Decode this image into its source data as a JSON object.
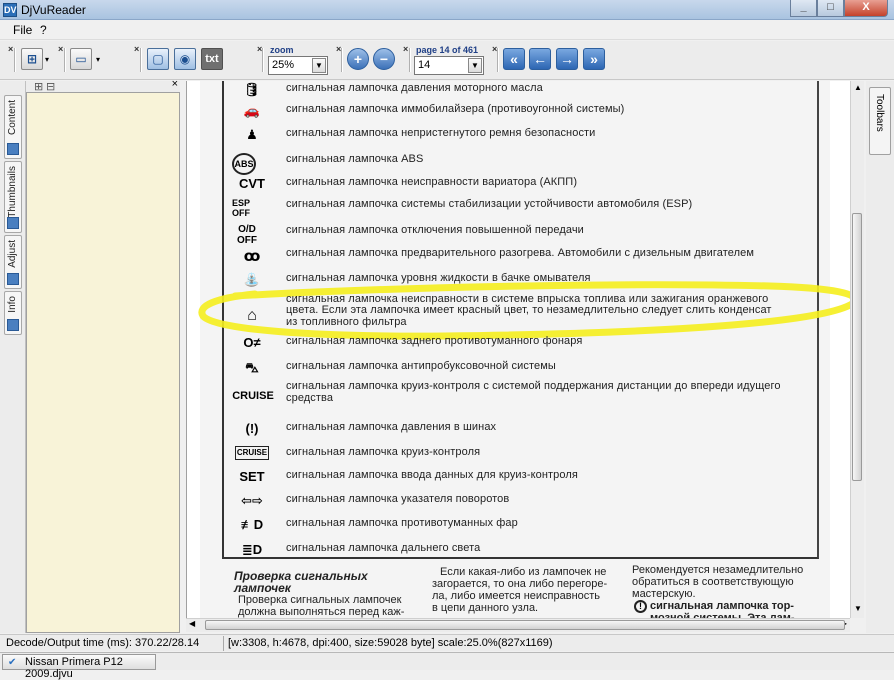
{
  "window": {
    "title": "DjVuReader",
    "app_icon": "DV",
    "minimize": "_",
    "maximize": "□",
    "close": "X"
  },
  "menu": {
    "file": "File",
    "help": "?"
  },
  "toolbar": {
    "zoom_label": "zoom",
    "zoom_value": "25%",
    "page_label": "page 14 of 461",
    "page_value": "14",
    "txt_button": "txt"
  },
  "sidebar": {
    "tabs": [
      "Content",
      "Thumbnails",
      "Adjust",
      "Info"
    ],
    "expand": "⊞",
    "collapse": "⊟"
  },
  "toolbars_tab": "Toolbars",
  "document": {
    "rows": [
      {
        "icon": "oil-can-icon",
        "glyph": "🛢",
        "text": "сигнальная лампочка давления моторного масла"
      },
      {
        "icon": "car-key-icon",
        "glyph": "🚗",
        "text": "сигнальная лампочка иммобилайзера (противоугонной системы)"
      },
      {
        "icon": "seatbelt-icon",
        "glyph": "♟",
        "text": "сигнальная лампочка непристегнутого ремня безопасности"
      },
      {
        "icon": "abs-icon",
        "glyph": "ABS",
        "text": "сигнальная лампочка ABS"
      },
      {
        "icon": "cvt-icon",
        "glyph": "CVT",
        "text": "сигнальная лампочка неисправности вариатора (АКПП)"
      },
      {
        "icon": "esp-off-icon",
        "glyph": "ESP OFF",
        "text": "сигнальная лампочка системы стабилизации устойчивости автомобиля (ESP)"
      },
      {
        "icon": "od-off-icon",
        "glyph": "O/D OFF",
        "text": "сигнальная лампочка отключения повышенной передачи"
      },
      {
        "icon": "glow-plug-icon",
        "glyph": "ꝏ",
        "text": "сигнальная лампочка предварительного разогрева. Автомобили с дизельным двигателем"
      },
      {
        "icon": "washer-fluid-icon",
        "glyph": "⛲",
        "text": "сигнальная лампочка уровня жидкости в бачке омывателя"
      },
      {
        "icon": "engine-icon",
        "glyph": "⌂",
        "text": "сигнальная лампочка неисправности в системе впрыска топлива или зажигания оранжевого",
        "text2": "цвета. Если эта лампочка имеет красный цвет, то незамедлительно следует слить конденсат",
        "text3": "из топливного фильтра"
      },
      {
        "icon": "rear-fog-icon",
        "glyph": "O≠",
        "text": "сигнальная лампочка заднего противотуманного фонаря"
      },
      {
        "icon": "traction-icon",
        "glyph": "⛍",
        "text": "сигнальная лампочка антипробуксовочной системы"
      },
      {
        "icon": "cruise-icon",
        "glyph": "CRUISE",
        "text": "сигнальная лампочка круиз-контроля с системой поддержания дистанции до впереди идущего",
        "text2": "средства"
      },
      {
        "icon": "tire-pressure-icon",
        "glyph": "(!)",
        "text": "сигнальная лампочка давления в шинах"
      },
      {
        "icon": "cruise-box-icon",
        "glyph": "CRUISE",
        "text": "сигнальная лампочка круиз-контроля"
      },
      {
        "icon": "set-icon",
        "glyph": "SET",
        "text": "сигнальная лампочка ввода данных для круиз-контроля"
      },
      {
        "icon": "turn-signal-icon",
        "glyph": "⇦⇨",
        "text": "сигнальная лампочка указателя поворотов"
      },
      {
        "icon": "front-fog-icon",
        "glyph": "≢D",
        "text": "сигнальная лампочка противотуманных фар"
      },
      {
        "icon": "high-beam-icon",
        "glyph": "≣D",
        "text": "сигнальная лампочка дальнего света"
      }
    ],
    "col1_title": "Проверка сигнальных",
    "col1_title2": "лампочек",
    "col1_line1": "Проверка сигнальных лампочек",
    "col1_line2": "должна выполняться перед каж-",
    "col2_line1": "Если какая-либо из лампочек не",
    "col2_line2": "загорается, то она либо перегоре-",
    "col2_line3": "ла, либо имеется неисправность",
    "col2_line4": "в цепи данного узла.",
    "col3_line1": "Рекомендуется незамедлительно",
    "col3_line2": "обратиться в соответствующую",
    "col3_line3": "мастерскую.",
    "col3_line4": "сигнальная лампочка тор-",
    "col3_line5": "мозной системы. Эта лам-"
  },
  "status": {
    "decode": "Decode/Output time (ms): 370.22/28.14",
    "info": "[w:3308, h:4678, dpi:400, size:59028 byte] scale:25.0%(827x1169)"
  },
  "taskbar": {
    "item": "Nissan Primera P12 2009.djvu"
  },
  "colors": {
    "highlight": "#f5ee1e",
    "panel_bg": "#f8f3d8"
  }
}
